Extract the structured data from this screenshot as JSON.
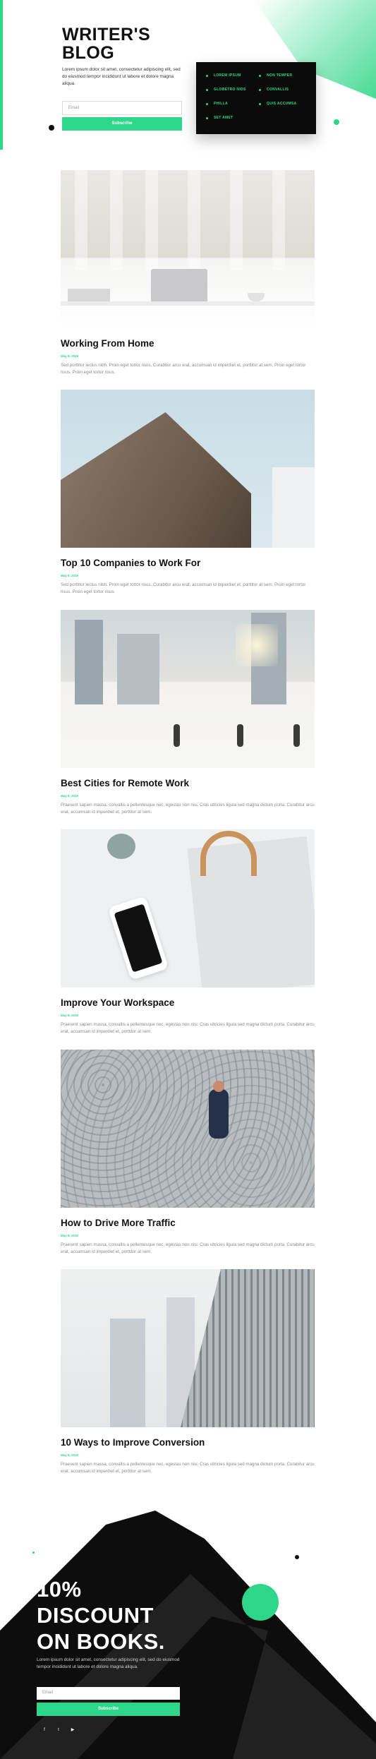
{
  "header": {
    "title_line1": "WRITER'S",
    "title_line2": "BLOG",
    "subtitle": "Lorem ipsum dolor sit amet, consectetur adipiscing elit, sed do eiusmod tempor incididunt ut labore et dolore magna aliqua.",
    "email_placeholder": "Email",
    "subscribe_label": "Subscribe",
    "categories": [
      "LOREM IPSUM",
      "GLOBETRO NIDS",
      "PHILLA",
      "SET AMET",
      "NON TEMPER",
      "CONVALLIS",
      "QUIS ACCUMSA"
    ],
    "accent_color": "#2ed68a"
  },
  "posts": [
    {
      "title": "Working From Home",
      "date": "May 8, 2019",
      "excerpt": "Sed porttitor lectus nibh. Proin eget tortor risus. Curabitur arcu erat, accumsan id imperdiet et, porttitor at sem. Proin eget tortor risus. Proin eget tortor risus."
    },
    {
      "title": "Top 10 Companies to Work For",
      "date": "May 8, 2019",
      "excerpt": "Sed porttitor lectus nibh. Proin eget tortor risus. Curabitur arcu erat, accumsan id imperdiet et, porttitor at sem. Proin eget tortor risus. Proin eget tortor risus."
    },
    {
      "title": "Best Cities for Remote Work",
      "date": "May 8, 2019",
      "excerpt": "Praesent sapien massa, convallis a pellentesque nec, egestas non nisi. Cras ultricies ligula sed magna dictum porta. Curabitur arcu erat, accumsan id imperdiet et, porttitor at sem."
    },
    {
      "title": "Improve Your Workspace",
      "date": "May 8, 2019",
      "excerpt": "Praesent sapien massa, convallis a pellentesque nec, egestas non nisi. Cras ultricies ligula sed magna dictum porta. Curabitur arcu erat, accumsan id imperdiet et, porttitor at sem."
    },
    {
      "title": "How to Drive More Traffic",
      "date": "May 8, 2019",
      "excerpt": "Praesent sapien massa, convallis a pellentesque nec, egestas non nisi. Cras ultricies ligula sed magna dictum porta. Curabitur arcu erat, accumsan id imperdiet et, porttitor at sem."
    },
    {
      "title": "10 Ways to Improve Conversion",
      "date": "May 8, 2019",
      "excerpt": "Praesent sapien massa, convallis a pellentesque nec, egestas non nisi. Cras ultricies ligula sed magna dictum porta. Curabitur arcu erat, accumsan id imperdiet et, porttitor at sem."
    }
  ],
  "footer": {
    "title_line1": "10%",
    "title_line2": "DISCOUNT",
    "title_line3": "ON BOOKS.",
    "subtitle": "Lorem ipsum dolor sit amet, consectetur adipiscing elit, sed do eiusmod tempor incididunt ut labore et dolore magna aliqua.",
    "email_placeholder": "Email",
    "subscribe_label": "Subscribe",
    "social_icons": [
      "facebook-icon",
      "twitter-icon",
      "youtube-icon"
    ],
    "social_glyphs": [
      "f",
      "t",
      "▶"
    ]
  }
}
